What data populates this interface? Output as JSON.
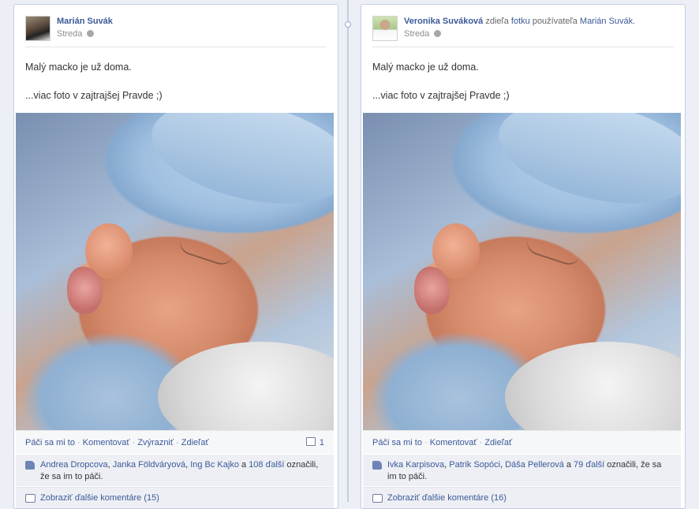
{
  "posts": [
    {
      "author": "Marián Suvák",
      "share_prefix": "",
      "share_link": "",
      "share_mid": "",
      "share_owner": "",
      "date": "Streda",
      "message_line1": "Malý macko je už doma.",
      "message_line2": "...viac foto v zajtrajšej Pravde ;)",
      "actions": {
        "like": "Páči sa mi to",
        "comment": "Komentovať",
        "promote": "Zvýrazniť",
        "share": "Zdieľať"
      },
      "comment_count": "1",
      "likes": {
        "names": [
          "Andrea Dropcova",
          "Janka Földváryová",
          "Ing Bc Kajko"
        ],
        "sep1": ", ",
        "sep2": ", ",
        "and": " a ",
        "others": "108 ďalší",
        "suffix": " označili, že sa im to páči."
      },
      "more_comments": "Zobraziť ďalšie komentáre (15)"
    },
    {
      "author": "Veronika Suváková",
      "share_prefix": " zdieľa ",
      "share_link": "fotku",
      "share_mid": " používateľa ",
      "share_owner": "Marián Suvák",
      "share_end": ".",
      "date": "Streda",
      "message_line1": "Malý macko je už doma.",
      "message_line2": "...viac foto v zajtrajšej Pravde ;)",
      "actions": {
        "like": "Páči sa mi to",
        "comment": "Komentovať",
        "share": "Zdieľať"
      },
      "likes": {
        "names": [
          "Ivka Karpisova",
          "Patrik Sopóci",
          "Dáša Pellerová"
        ],
        "sep1": ", ",
        "sep2": ", ",
        "and": " a ",
        "others": "79 ďalší",
        "suffix": " označili, že sa im to páči."
      },
      "more_comments": "Zobraziť ďalšie komentáre (16)"
    }
  ],
  "separator": " · ",
  "icons": {
    "privacy": "globe-icon",
    "like": "thumbs-up-icon",
    "comments": "comment-bubble-icon"
  },
  "colors": {
    "link": "#3b5998",
    "background": "#eceff5",
    "actions_bar": "#f6f7f9",
    "likes_bar": "#edeff4"
  }
}
